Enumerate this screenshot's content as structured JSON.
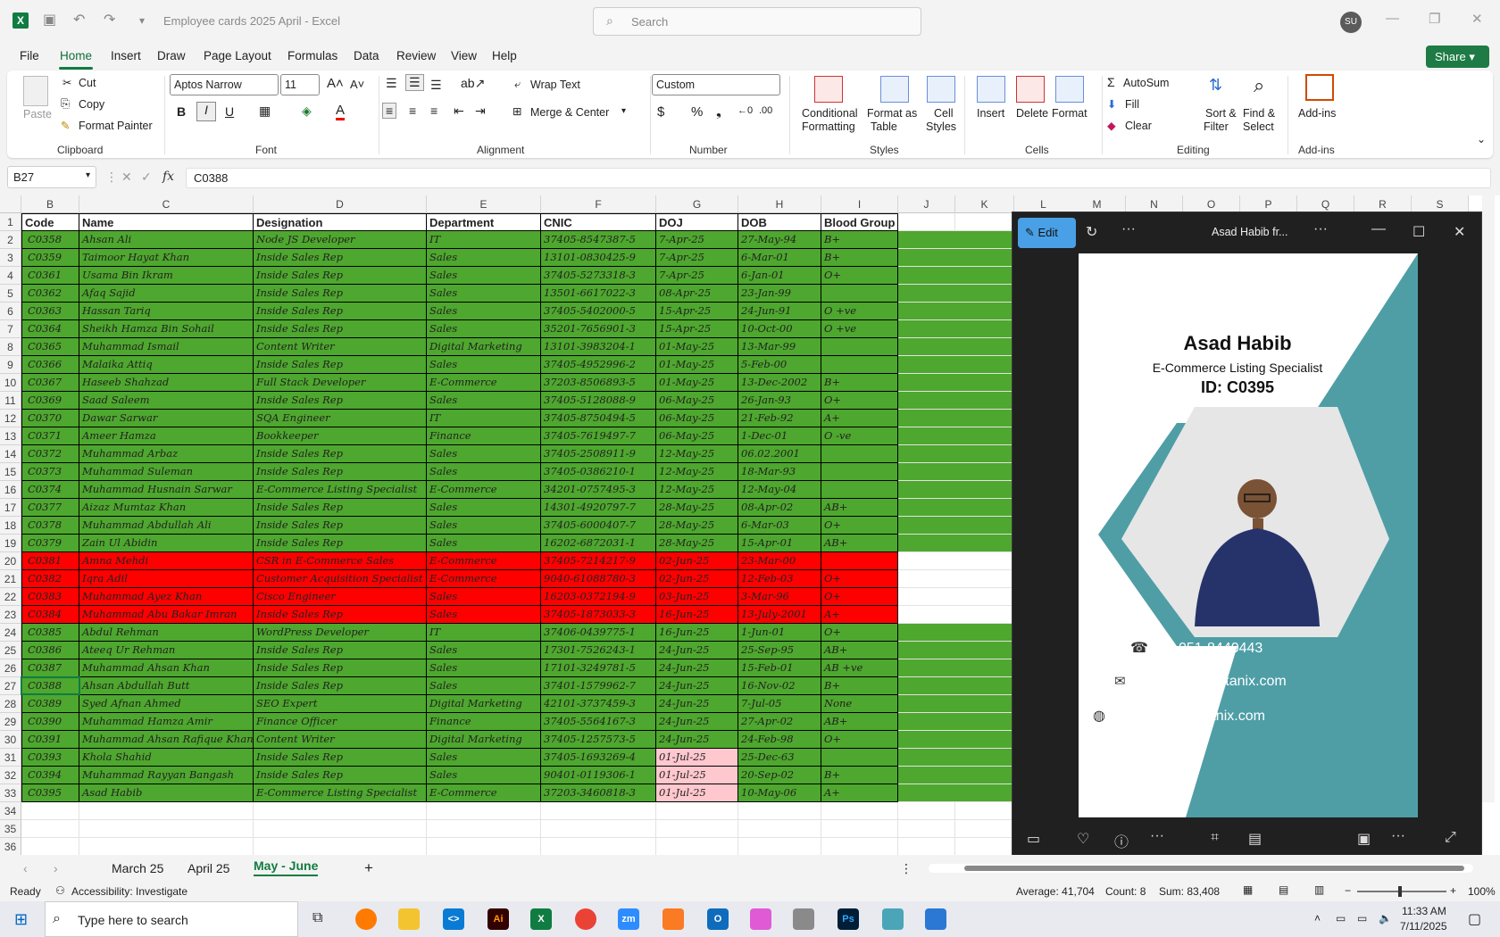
{
  "app": {
    "doc_title": "Employee cards 2025 April  -  Excel",
    "search_placeholder": "Search",
    "user_initials": "SU",
    "share_label": "Share"
  },
  "menu": [
    "File",
    "Home",
    "Insert",
    "Draw",
    "Page Layout",
    "Formulas",
    "Data",
    "Review",
    "View",
    "Help"
  ],
  "ribbon": {
    "clipboard": {
      "paste": "Paste",
      "cut": "Cut",
      "copy": "Copy",
      "format_painter": "Format Painter",
      "group": "Clipboard"
    },
    "font": {
      "name": "Aptos Narrow",
      "size": "11",
      "group": "Font"
    },
    "alignment": {
      "wrap": "Wrap Text",
      "merge": "Merge & Center",
      "group": "Alignment"
    },
    "number": {
      "format": "Custom",
      "group": "Number"
    },
    "styles": {
      "conditional": "Conditional",
      "conditional2": "Formatting",
      "format_table": "Format as",
      "format_table2": "Table",
      "cell_styles": "Cell",
      "cell_styles2": "Styles",
      "group": "Styles"
    },
    "cells": {
      "insert": "Insert",
      "delete": "Delete",
      "format": "Format",
      "group": "Cells"
    },
    "editing": {
      "autosum": "AutoSum",
      "fill": "Fill",
      "clear": "Clear",
      "sort": "Sort &",
      "sort2": "Filter",
      "find": "Find &",
      "find2": "Select",
      "group": "Editing"
    },
    "addins": {
      "label": "Add-ins",
      "group": "Add-ins"
    }
  },
  "formula_bar": {
    "name_box": "B27",
    "formula": "C0388"
  },
  "columns": [
    "B",
    "C",
    "D",
    "E",
    "F",
    "G",
    "H",
    "I",
    "J",
    "K",
    "L",
    "M",
    "N",
    "O",
    "P",
    "Q",
    "R",
    "S"
  ],
  "headers": [
    "Code",
    "Name",
    "Designation",
    "Department",
    "CNIC",
    "DOJ",
    "DOB",
    "Blood Group"
  ],
  "rows": [
    {
      "n": "2",
      "s": "g",
      "c": [
        "C0358",
        "Ahsan Ali",
        "Node JS Developer",
        "IT",
        "37405-8547387-5",
        "7-Apr-25",
        "27-May-94",
        "B+"
      ]
    },
    {
      "n": "3",
      "s": "g",
      "c": [
        "C0359",
        "Taimoor Hayat Khan",
        "Inside Sales Rep",
        "Sales",
        "13101-0830425-9",
        "7-Apr-25",
        "6-Mar-01",
        "B+"
      ]
    },
    {
      "n": "4",
      "s": "g",
      "c": [
        "C0361",
        "Usama Bin Ikram",
        "Inside Sales Rep",
        "Sales",
        "37405-5273318-3",
        "7-Apr-25",
        "6-Jan-01",
        "O+"
      ]
    },
    {
      "n": "5",
      "s": "g",
      "c": [
        "C0362",
        "Afaq Sajid",
        "Inside Sales Rep",
        "Sales",
        "13501-6617022-3",
        "08-Apr-25",
        "23-Jan-99",
        ""
      ]
    },
    {
      "n": "6",
      "s": "g",
      "c": [
        "C0363",
        "Hassan Tariq",
        "Inside Sales Rep",
        "Sales",
        "37405-5402000-5",
        "15-Apr-25",
        "24-Jun-91",
        "O +ve"
      ]
    },
    {
      "n": "7",
      "s": "g",
      "c": [
        "C0364",
        "Sheikh Hamza Bin Sohail",
        "Inside Sales Rep",
        "Sales",
        "35201-7656901-3",
        "15-Apr-25",
        "10-Oct-00",
        "O +ve"
      ]
    },
    {
      "n": "8",
      "s": "g",
      "c": [
        "C0365",
        "Muhammad Ismail",
        "Content Writer",
        "Digital Marketing",
        "13101-3983204-1",
        "01-May-25",
        "13-Mar-99",
        ""
      ]
    },
    {
      "n": "9",
      "s": "g",
      "c": [
        "C0366",
        "Malaika Attiq",
        "Inside Sales Rep",
        "Sales",
        "37405-4952996-2",
        "01-May-25",
        "5-Feb-00",
        ""
      ]
    },
    {
      "n": "10",
      "s": "g",
      "c": [
        "C0367",
        "Haseeb Shahzad",
        "Full Stack Developer",
        "E-Commerce",
        "37203-8506893-5",
        "01-May-25",
        "13-Dec-2002",
        "B+"
      ]
    },
    {
      "n": "11",
      "s": "g",
      "c": [
        "C0369",
        "Saad Saleem",
        "Inside Sales Rep",
        "Sales",
        "37405-5128088-9",
        "06-May-25",
        "26-Jan-93",
        "O+"
      ]
    },
    {
      "n": "12",
      "s": "g",
      "c": [
        "C0370",
        "Dawar Sarwar",
        "SQA Engineer",
        "IT",
        "37405-8750494-5",
        "06-May-25",
        "21-Feb-92",
        "A+"
      ]
    },
    {
      "n": "13",
      "s": "g",
      "c": [
        "C0371",
        "Ameer Hamza",
        "Bookkeeper",
        "Finance",
        "37405-7619497-7",
        "06-May-25",
        "1-Dec-01",
        "O -ve"
      ]
    },
    {
      "n": "14",
      "s": "g",
      "c": [
        "C0372",
        "Muhammad Arbaz",
        "Inside Sales Rep",
        "Sales",
        "37405-2508911-9",
        "12-May-25",
        "06.02.2001",
        ""
      ]
    },
    {
      "n": "15",
      "s": "g",
      "c": [
        "C0373",
        "Muhammad Suleman",
        "Inside Sales Rep",
        "Sales",
        "37405-0386210-1",
        "12-May-25",
        "18-Mar-93",
        ""
      ]
    },
    {
      "n": "16",
      "s": "g",
      "c": [
        "C0374",
        "Muhammad Husnain Sarwar",
        "E-Commerce Listing Specialist",
        "E-Commerce",
        "34201-0757495-3",
        "12-May-25",
        "12-May-04",
        ""
      ]
    },
    {
      "n": "17",
      "s": "g",
      "c": [
        "C0377",
        "Aizaz Mumtaz Khan",
        "Inside Sales Rep",
        "Sales",
        "14301-4920797-7",
        "28-May-25",
        "08-Apr-02",
        "AB+"
      ]
    },
    {
      "n": "18",
      "s": "g",
      "c": [
        "C0378",
        "Muhammad Abdullah Ali",
        "Inside Sales Rep",
        "Sales",
        "37405-6000407-7",
        "28-May-25",
        "6-Mar-03",
        "O+"
      ]
    },
    {
      "n": "19",
      "s": "g",
      "c": [
        "C0379",
        "Zain Ul Abidin",
        "Inside Sales Rep",
        "Sales",
        "16202-6872031-1",
        "28-May-25",
        "15-Apr-01",
        "AB+"
      ]
    },
    {
      "n": "20",
      "s": "r",
      "c": [
        "C0381",
        "Amna Mehdi",
        "CSR in E-Commerce Sales",
        "E-Commerce",
        "37405-7214217-9",
        "02-Jun-25",
        "23-Mar-00",
        ""
      ]
    },
    {
      "n": "21",
      "s": "r",
      "c": [
        "C0382",
        "Iqra Adil",
        "Customer Acquisition Specialist",
        "E-Commerce",
        "9040-61088780-3",
        "02-Jun-25",
        "12-Feb-03",
        "O+"
      ]
    },
    {
      "n": "22",
      "s": "r",
      "c": [
        "C0383",
        "Muhammad Ayez Khan",
        "Cisco Engineer",
        "Sales",
        "16203-0372194-9",
        "03-Jun-25",
        "3-Mar-96",
        "O+"
      ]
    },
    {
      "n": "23",
      "s": "r",
      "c": [
        "C0384",
        "Muhammad Abu Bakar Imran",
        "Inside Sales Rep",
        "Sales",
        "37405-1873033-3",
        "16-Jun-25",
        "13-July-2001",
        "A+"
      ]
    },
    {
      "n": "24",
      "s": "g",
      "c": [
        "C0385",
        "Abdul Rehman",
        "WordPress Developer",
        "IT",
        "37406-0439775-1",
        "16-Jun-25",
        "1-Jun-01",
        "O+"
      ]
    },
    {
      "n": "25",
      "s": "g",
      "c": [
        "C0386",
        "Ateeq Ur Rehman",
        "Inside Sales Rep",
        "Sales",
        "17301-7526243-1",
        "24-Jun-25",
        "25-Sep-95",
        "AB+"
      ]
    },
    {
      "n": "26",
      "s": "g",
      "c": [
        "C0387",
        "Muhammad Ahsan Khan",
        "Inside Sales Rep",
        "Sales",
        "17101-3249781-5",
        "24-Jun-25",
        "15-Feb-01",
        "AB +ve"
      ]
    },
    {
      "n": "27",
      "s": "g",
      "c": [
        "C0388",
        "Ahsan Abdullah Butt",
        "Inside Sales Rep",
        "Sales",
        "37401-1579962-7",
        "24-Jun-25",
        "16-Nov-02",
        "B+"
      ]
    },
    {
      "n": "28",
      "s": "g",
      "c": [
        "C0389",
        "Syed Afnan Ahmed",
        "SEO Expert",
        "Digital Marketing",
        "42101-3737459-3",
        "24-Jun-25",
        "7-Jul-05",
        "None"
      ]
    },
    {
      "n": "29",
      "s": "g",
      "c": [
        "C0390",
        "Muhammad Hamza Amir",
        "Finance Officer",
        "Finance",
        "37405-5564167-3",
        "24-Jun-25",
        "27-Apr-02",
        "AB+"
      ]
    },
    {
      "n": "30",
      "s": "g",
      "c": [
        "C0391",
        "Muhammad Ahsan Rafique Khan",
        "Content Writer",
        "Digital Marketing",
        "37405-1257573-5",
        "24-Jun-25",
        "24-Feb-98",
        "O+"
      ]
    },
    {
      "n": "31",
      "s": "p",
      "c": [
        "C0393",
        "Khola Shahid",
        "Inside Sales Rep",
        "Sales",
        "37405-1693269-4",
        "01-Jul-25",
        "25-Dec-63",
        ""
      ]
    },
    {
      "n": "32",
      "s": "p",
      "c": [
        "C0394",
        "Muhammad Rayyan Bangash",
        "Inside Sales Rep",
        "Sales",
        "90401-0119306-1",
        "01-Jul-25",
        "20-Sep-02",
        "B+"
      ]
    },
    {
      "n": "33",
      "s": "p",
      "c": [
        "C0395",
        "Asad Habib",
        "E-Commerce Listing Specialist",
        "E-Commerce",
        "37203-3460818-3",
        "01-Jul-25",
        "10-May-06",
        "A+"
      ]
    }
  ],
  "empty_rows": [
    "34",
    "35",
    "36"
  ],
  "header_row_num": "1",
  "sheets": [
    "March 25",
    "April 25",
    "May - June"
  ],
  "status": {
    "ready": "Ready",
    "accessibility": "Accessibility: Investigate",
    "average": "Average: 41,704",
    "count": "Count: 8",
    "sum": "Sum: 83,408",
    "zoom": "100%"
  },
  "taskbar": {
    "search": "Type here to search",
    "time": "11:33 AM",
    "date": "7/11/2025"
  },
  "viewer": {
    "edit": "Edit",
    "title": "Asad Habib fr...",
    "card": {
      "name": "Asad Habib",
      "role": "E-Commerce Listing Specialist",
      "id": "ID: C0395",
      "phone": "051-8440443",
      "email": "info@comtanix.com",
      "web": "www.comtanix.com"
    }
  },
  "colors": {
    "green": "#4ea72e",
    "red": "#ff0000",
    "pink": "#ffc7ce",
    "excel": "#107c41",
    "teal": "#4f9ea6"
  }
}
